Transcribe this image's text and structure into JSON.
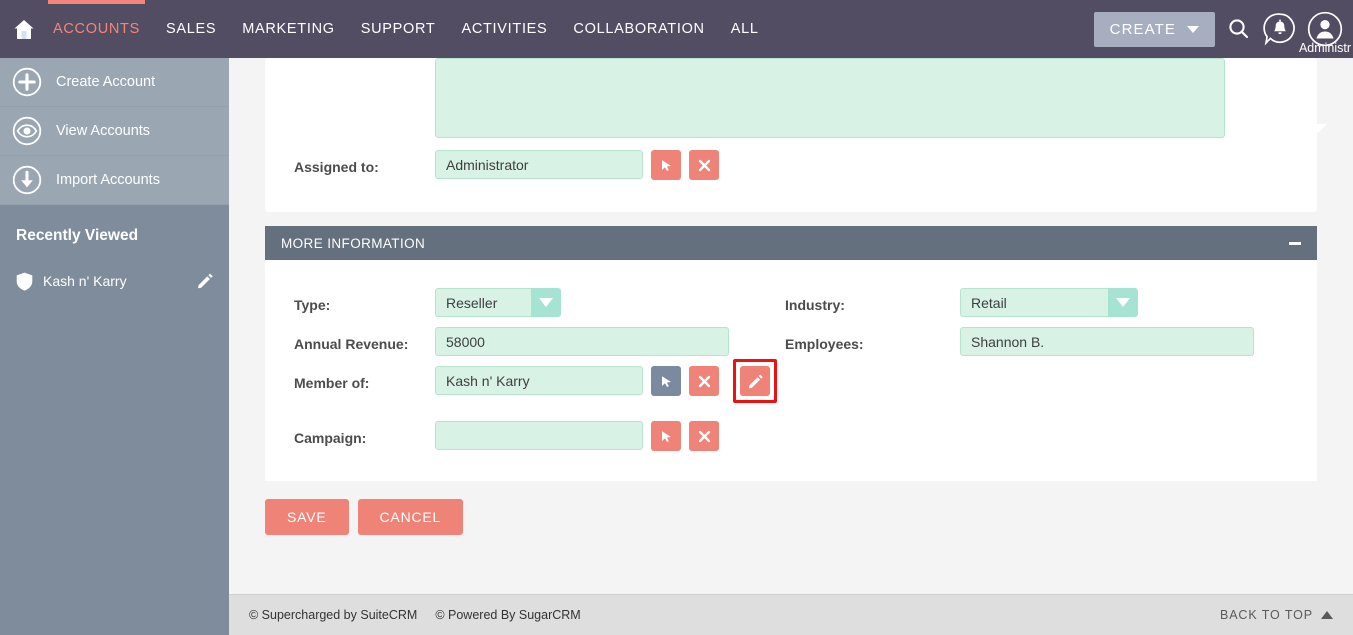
{
  "topnav": {
    "home_icon": "home-icon",
    "items": [
      {
        "label": "ACCOUNTS",
        "active": true
      },
      {
        "label": "SALES",
        "active": false
      },
      {
        "label": "MARKETING",
        "active": false
      },
      {
        "label": "SUPPORT",
        "active": false
      },
      {
        "label": "ACTIVITIES",
        "active": false
      },
      {
        "label": "COLLABORATION",
        "active": false
      },
      {
        "label": "ALL",
        "active": false
      }
    ],
    "create_label": "CREATE",
    "search_icon": "search-icon",
    "notification_icon": "notification-bell-icon",
    "avatar_icon": "user-avatar-icon",
    "user_name": "Administr",
    "accent_color": "#f4857a",
    "bar_color": "#534d64"
  },
  "sidebar": {
    "actions": [
      {
        "label": "Create Account",
        "icon": "plus-circle-icon"
      },
      {
        "label": "View Accounts",
        "icon": "eye-circle-icon"
      },
      {
        "label": "Import Accounts",
        "icon": "download-circle-icon"
      }
    ],
    "recent_heading": "Recently Viewed",
    "recent_items": [
      {
        "label": "Kash n' Karry",
        "icon": "shield-icon",
        "edit_icon": "pencil-icon"
      }
    ],
    "collapse_icon": "collapse-left-icon",
    "bg_color": "#7f8c9b"
  },
  "form": {
    "description": {
      "value": "",
      "placeholder": ""
    },
    "assigned_to": {
      "label": "Assigned to:",
      "value": "Administrator",
      "select_icon": "arrow-select-icon",
      "clear_icon": "clear-x-icon"
    },
    "panel": {
      "title": "MORE INFORMATION",
      "collapse_icon": "minus-icon"
    },
    "type": {
      "label": "Type:",
      "value": "Reseller",
      "dropdown_icon": "chevron-down-icon"
    },
    "industry": {
      "label": "Industry:",
      "value": "Retail",
      "dropdown_icon": "chevron-down-icon"
    },
    "annual_revenue": {
      "label": "Annual Revenue:",
      "value": "58000"
    },
    "employees": {
      "label": "Employees:",
      "value": "Shannon B."
    },
    "member_of": {
      "label": "Member of:",
      "value": "Kash n' Karry",
      "select_icon": "arrow-select-icon",
      "clear_icon": "clear-x-icon",
      "edit_icon": "pencil-edit-icon",
      "edit_highlighted": true,
      "highlight_color": "#ee1111"
    },
    "campaign": {
      "label": "Campaign:",
      "value": "",
      "select_icon": "arrow-select-icon",
      "clear_icon": "clear-x-icon"
    },
    "save_label": "SAVE",
    "cancel_label": "CANCEL",
    "button_color": "#f08377",
    "input_color": "#d9f2e6"
  },
  "footer": {
    "supercharged": "© Supercharged by SuiteCRM",
    "powered": "© Powered By SugarCRM",
    "back_to_top": "BACK TO TOP",
    "back_to_top_icon": "triangle-up-icon"
  }
}
